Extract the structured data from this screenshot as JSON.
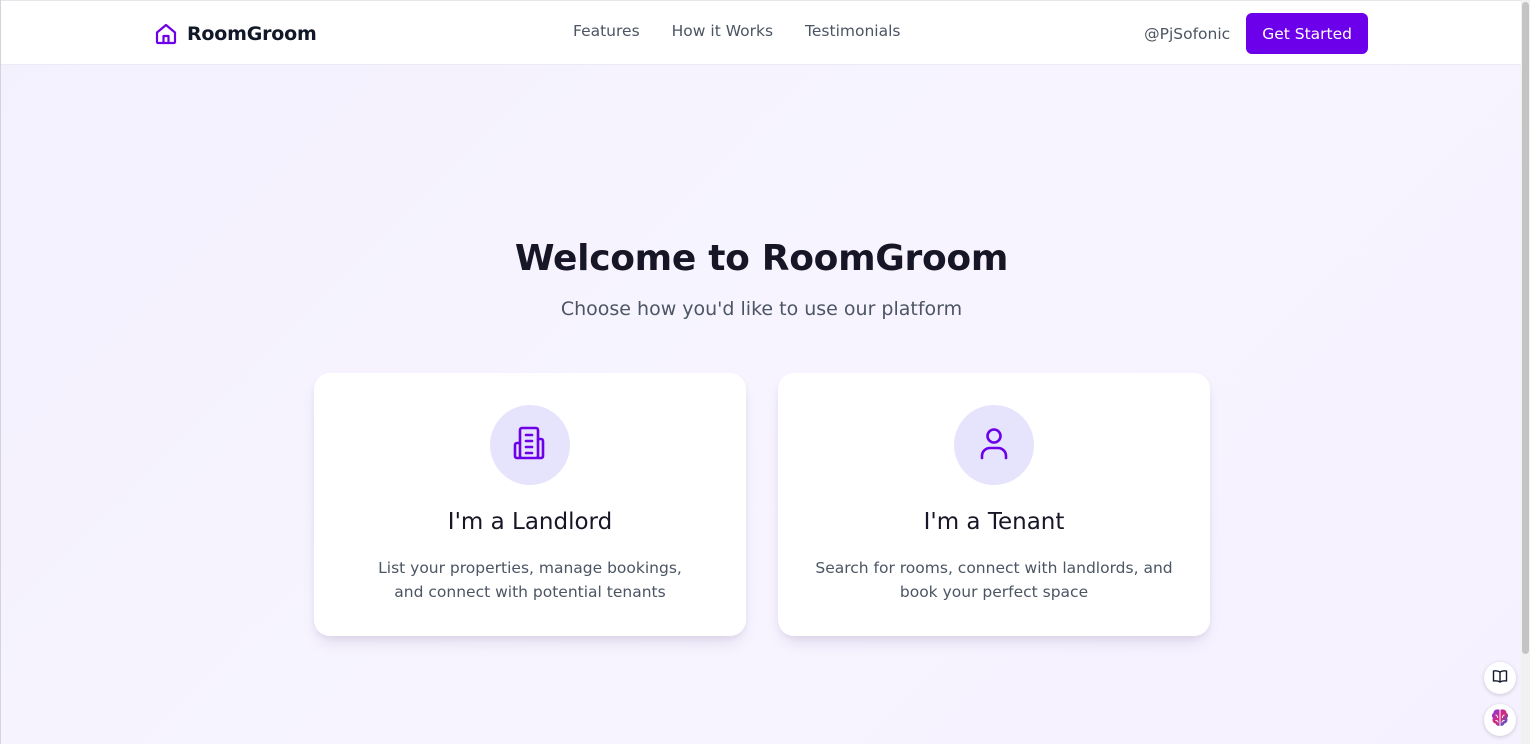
{
  "brand": {
    "name": "RoomGroom",
    "logo_icon": "house-icon",
    "accent": "#6d00ea"
  },
  "nav": {
    "links": [
      "Features",
      "How it Works",
      "Testimonials"
    ],
    "user_handle": "@PjSofonic",
    "cta_label": "Get Started"
  },
  "hero": {
    "title": "Welcome to RoomGroom",
    "subtitle": "Choose how you'd like to use our platform"
  },
  "cards": [
    {
      "icon": "building-icon",
      "title": "I'm a Landlord",
      "description": "List your properties, manage bookings, and connect with potential tenants"
    },
    {
      "icon": "user-icon",
      "title": "I'm a Tenant",
      "description": "Search for rooms, connect with landlords, and book your perfect space"
    }
  ],
  "floating_widgets": [
    "book-icon",
    "brain-icon"
  ]
}
